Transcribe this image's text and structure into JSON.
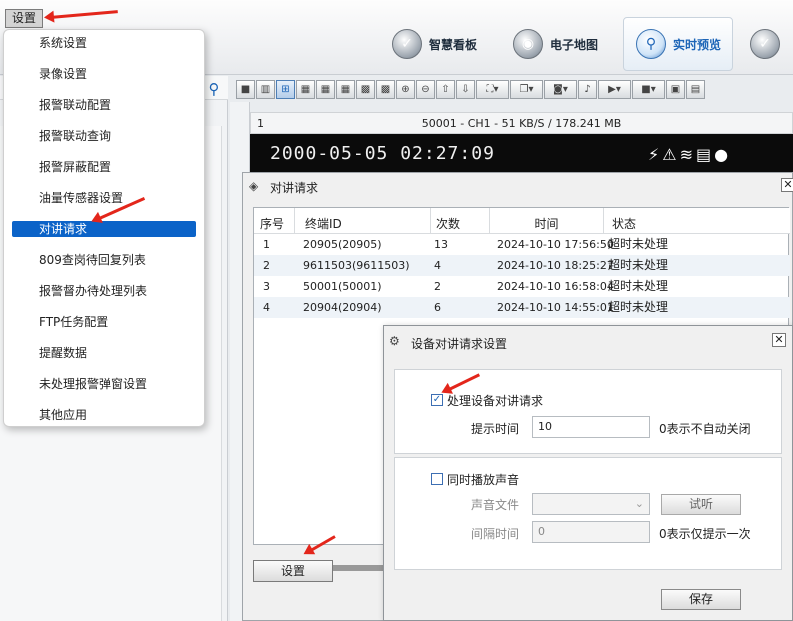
{
  "topnav": {
    "items": [
      {
        "label": "智慧看板"
      },
      {
        "label": "电子地图"
      },
      {
        "label": "实时预览"
      }
    ]
  },
  "menu": {
    "root_label": "设置",
    "items": [
      {
        "label": "系统设置"
      },
      {
        "label": "录像设置"
      },
      {
        "label": "报警联动配置"
      },
      {
        "label": "报警联动查询"
      },
      {
        "label": "报警屏蔽配置"
      },
      {
        "label": "油量传感器设置"
      },
      {
        "label": "对讲请求"
      },
      {
        "label": "809查岗待回复列表"
      },
      {
        "label": "报警督办待处理列表"
      },
      {
        "label": "FTP任务配置"
      },
      {
        "label": "提醒数据"
      },
      {
        "label": "未处理报警弹窗设置"
      },
      {
        "label": "其他应用"
      }
    ]
  },
  "video": {
    "channel_no": "1",
    "stream_info": "50001 - CH1 - 51 KB/S / 178.241 MB",
    "timestamp": "2000-05-05 02:27:09"
  },
  "intercom_window": {
    "title": "对讲请求",
    "columns": [
      "序号",
      "终端ID",
      "次数",
      "时间",
      "状态"
    ],
    "rows": [
      {
        "no": "1",
        "terminal": "20905(20905)",
        "count": "13",
        "time": "2024-10-10 17:56:50",
        "status": "超时未处理"
      },
      {
        "no": "2",
        "terminal": "9611503(9611503)",
        "count": "4",
        "time": "2024-10-10 18:25:27",
        "status": "超时未处理"
      },
      {
        "no": "3",
        "terminal": "50001(50001)",
        "count": "2",
        "time": "2024-10-10 16:58:04",
        "status": "超时未处理"
      },
      {
        "no": "4",
        "terminal": "20904(20904)",
        "count": "6",
        "time": "2024-10-10 14:55:01",
        "status": "超时未处理"
      }
    ],
    "settings_button": "设置"
  },
  "device_dialog": {
    "title": "设备对讲请求设置",
    "handle_request_label": "处理设备对讲请求",
    "handle_request_checked": true,
    "prompt_time_label": "提示时间",
    "prompt_time_value": "10",
    "prompt_time_hint": "0表示不自动关闭",
    "play_sound_label": "同时播放声音",
    "play_sound_checked": false,
    "sound_file_label": "声音文件",
    "listen_button": "试听",
    "interval_label": "间隔时间",
    "interval_value": "0",
    "interval_hint": "0表示仅提示一次",
    "save_button": "保存"
  },
  "colors": {
    "accent": "#0b63c8",
    "annotation_arrow": "#e3261b"
  }
}
